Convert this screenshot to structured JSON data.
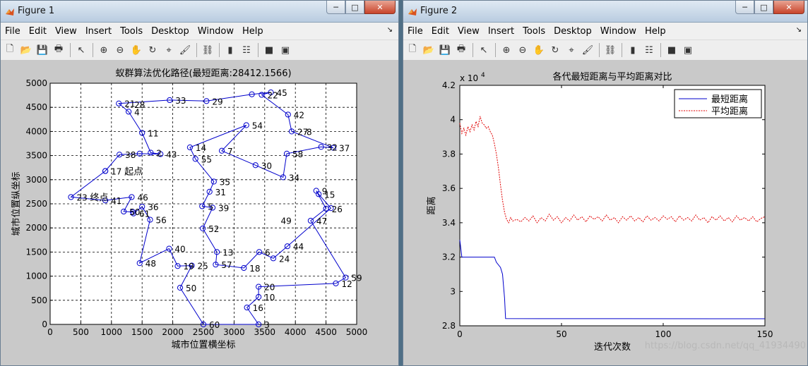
{
  "window1": {
    "title": "Figure 1",
    "menus": [
      "File",
      "Edit",
      "View",
      "Insert",
      "Tools",
      "Desktop",
      "Window",
      "Help"
    ],
    "toolbar_icons": [
      "new-file-icon",
      "open-folder-icon",
      "save-icon",
      "print-icon",
      "|",
      "pointer-icon",
      "|",
      "zoom-in-icon",
      "zoom-out-icon",
      "pan-hand-icon",
      "rotate-icon",
      "data-cursor-icon",
      "brush-icon",
      "|",
      "link-plot-icon",
      "|",
      "colorbar-icon",
      "legend-icon",
      "|",
      "hide-plot-tools-icon",
      "show-plot-tools-icon"
    ]
  },
  "window2": {
    "title": "Figure 2",
    "menus": [
      "File",
      "Edit",
      "View",
      "Insert",
      "Tools",
      "Desktop",
      "Window",
      "Help"
    ],
    "toolbar_icons": [
      "new-file-icon",
      "open-folder-icon",
      "save-icon",
      "print-icon",
      "|",
      "pointer-icon",
      "|",
      "zoom-in-icon",
      "zoom-out-icon",
      "pan-hand-icon",
      "rotate-icon",
      "data-cursor-icon",
      "brush-icon",
      "|",
      "link-plot-icon",
      "|",
      "colorbar-icon",
      "legend-icon",
      "|",
      "hide-plot-tools-icon",
      "show-plot-tools-icon"
    ]
  },
  "chart_data": [
    {
      "type": "line",
      "title": "蚁群算法优化路径(最短距离:28412.1566)",
      "xlabel": "城市位置横坐标",
      "ylabel": "城市位置纵坐标",
      "xlim": [
        0,
        5000
      ],
      "ylim": [
        0,
        5000
      ],
      "xticks": [
        0,
        500,
        1000,
        1500,
        2000,
        2500,
        3000,
        3500,
        4000,
        4500,
        5000
      ],
      "yticks": [
        0,
        500,
        1000,
        1500,
        2000,
        2500,
        3000,
        3500,
        4000,
        4500,
        5000
      ],
      "grid": true,
      "line_color": "#0000cc",
      "marker": "circle",
      "start_label": "起点",
      "end_label": "终点",
      "route": [
        [
          900,
          3180
        ],
        [
          340,
          2640
        ],
        [
          900,
          2570
        ],
        [
          1330,
          2640
        ],
        [
          1200,
          2340
        ],
        [
          1350,
          2330
        ],
        [
          1360,
          2300
        ],
        [
          1500,
          2440
        ],
        [
          1630,
          2170
        ],
        [
          1460,
          1270
        ],
        [
          1940,
          1570
        ],
        [
          2080,
          1210
        ],
        [
          2310,
          1220
        ],
        [
          2120,
          760
        ],
        [
          2500,
          0
        ],
        [
          3400,
          0
        ],
        [
          3210,
          350
        ],
        [
          3400,
          570
        ],
        [
          3400,
          780
        ],
        [
          4660,
          850
        ],
        [
          4820,
          970
        ],
        [
          4250,
          2150
        ],
        [
          4500,
          2400
        ],
        [
          4340,
          2770
        ],
        [
          4380,
          2700
        ],
        [
          4580,
          2410
        ],
        [
          3870,
          1620
        ],
        [
          3640,
          1370
        ],
        [
          3410,
          1500
        ],
        [
          3160,
          1170
        ],
        [
          2700,
          1240
        ],
        [
          2720,
          1500
        ],
        [
          2490,
          1990
        ],
        [
          2650,
          2420
        ],
        [
          2480,
          2450
        ],
        [
          2600,
          2750
        ],
        [
          2670,
          2960
        ],
        [
          2370,
          3430
        ],
        [
          2280,
          3670
        ],
        [
          3200,
          4130
        ],
        [
          2800,
          3600
        ],
        [
          3350,
          3300
        ],
        [
          3800,
          3050
        ],
        [
          3860,
          3540
        ],
        [
          4420,
          3680
        ],
        [
          4620,
          3660
        ],
        [
          3940,
          4000
        ],
        [
          3880,
          4350
        ],
        [
          3450,
          4760
        ],
        [
          3600,
          4810
        ],
        [
          3290,
          4770
        ],
        [
          2550,
          4630
        ],
        [
          1950,
          4650
        ],
        [
          1120,
          4580
        ],
        [
          1280,
          4410
        ],
        [
          1500,
          3970
        ],
        [
          1640,
          3560
        ],
        [
          1800,
          3530
        ],
        [
          1460,
          3540
        ],
        [
          1130,
          3520
        ],
        [
          900,
          3180
        ]
      ],
      "point_labels": [
        {
          "x": 900,
          "y": 3180,
          "text": "17"
        },
        {
          "x": 340,
          "y": 2640,
          "text": "23"
        },
        {
          "x": 900,
          "y": 2570,
          "text": "41"
        },
        {
          "x": 1330,
          "y": 2640,
          "text": "46"
        },
        {
          "x": 1200,
          "y": 2340,
          "text": "50"
        },
        {
          "x": 1360,
          "y": 2300,
          "text": "61"
        },
        {
          "x": 1500,
          "y": 2440,
          "text": "36"
        },
        {
          "x": 1630,
          "y": 2170,
          "text": "56"
        },
        {
          "x": 1460,
          "y": 1270,
          "text": "48"
        },
        {
          "x": 1940,
          "y": 1570,
          "text": "40"
        },
        {
          "x": 2080,
          "y": 1210,
          "text": "19"
        },
        {
          "x": 2310,
          "y": 1220,
          "text": "25"
        },
        {
          "x": 2120,
          "y": 760,
          "text": "50"
        },
        {
          "x": 2500,
          "y": 0,
          "text": "60"
        },
        {
          "x": 3400,
          "y": 0,
          "text": "3"
        },
        {
          "x": 3210,
          "y": 350,
          "text": "16"
        },
        {
          "x": 3400,
          "y": 570,
          "text": "10"
        },
        {
          "x": 3400,
          "y": 780,
          "text": "20"
        },
        {
          "x": 4660,
          "y": 850,
          "text": "12"
        },
        {
          "x": 4820,
          "y": 970,
          "text": "59"
        },
        {
          "x": 4250,
          "y": 2150,
          "text": "47"
        },
        {
          "x": 4500,
          "y": 2400,
          "text": "26"
        },
        {
          "x": 4340,
          "y": 2770,
          "text": "9"
        },
        {
          "x": 4380,
          "y": 2700,
          "text": "15"
        },
        {
          "x": 3870,
          "y": 1620,
          "text": "44"
        },
        {
          "x": 3640,
          "y": 1370,
          "text": "24"
        },
        {
          "x": 3410,
          "y": 1500,
          "text": "6"
        },
        {
          "x": 3160,
          "y": 1170,
          "text": "18"
        },
        {
          "x": 2700,
          "y": 1240,
          "text": "57"
        },
        {
          "x": 2720,
          "y": 1500,
          "text": "13"
        },
        {
          "x": 2490,
          "y": 1990,
          "text": "52"
        },
        {
          "x": 2650,
          "y": 2420,
          "text": "39"
        },
        {
          "x": 2480,
          "y": 2450,
          "text": "5"
        },
        {
          "x": 2600,
          "y": 2750,
          "text": "31"
        },
        {
          "x": 2670,
          "y": 2960,
          "text": "35"
        },
        {
          "x": 2370,
          "y": 3430,
          "text": "55"
        },
        {
          "x": 2280,
          "y": 3670,
          "text": "14"
        },
        {
          "x": 3200,
          "y": 4130,
          "text": "54"
        },
        {
          "x": 2800,
          "y": 3600,
          "text": "7"
        },
        {
          "x": 3350,
          "y": 3300,
          "text": "30"
        },
        {
          "x": 3800,
          "y": 3050,
          "text": "34"
        },
        {
          "x": 3860,
          "y": 3540,
          "text": "58"
        },
        {
          "x": 4420,
          "y": 3680,
          "text": "32"
        },
        {
          "x": 4620,
          "y": 3660,
          "text": "37"
        },
        {
          "x": 3940,
          "y": 4000,
          "text": "27"
        },
        {
          "x": 4090,
          "y": 4000,
          "text": "8"
        },
        {
          "x": 3670,
          "y": 2160,
          "text": "49"
        },
        {
          "x": 3880,
          "y": 4350,
          "text": "42"
        },
        {
          "x": 3450,
          "y": 4760,
          "text": "22"
        },
        {
          "x": 3600,
          "y": 4810,
          "text": "45"
        },
        {
          "x": 2550,
          "y": 4630,
          "text": "29"
        },
        {
          "x": 1950,
          "y": 4650,
          "text": "33"
        },
        {
          "x": 1120,
          "y": 4580,
          "text": "21"
        },
        {
          "x": 1280,
          "y": 4560,
          "text": "28"
        },
        {
          "x": 1280,
          "y": 4410,
          "text": "4"
        },
        {
          "x": 1500,
          "y": 3970,
          "text": "11"
        },
        {
          "x": 1640,
          "y": 3560,
          "text": "2"
        },
        {
          "x": 1800,
          "y": 3530,
          "text": "43"
        },
        {
          "x": 1130,
          "y": 3520,
          "text": "38"
        }
      ]
    },
    {
      "type": "line",
      "title": "各代最短距离与平均距离对比",
      "xlabel": "迭代次数",
      "ylabel": "距离",
      "xlim": [
        0,
        150
      ],
      "ylim": [
        28000,
        42000
      ],
      "xticks": [
        0,
        50,
        100,
        150
      ],
      "yticks": [
        "2.8",
        "3",
        "3.2",
        "3.4",
        "3.6",
        "3.8",
        "4",
        "4.2"
      ],
      "y_exponent_label": "x 10",
      "y_exponent": "4",
      "grid": false,
      "legend_position": "top-right",
      "series": [
        {
          "name": "最短距离",
          "color": "#0000cc",
          "dash": "solid",
          "points": [
            [
              0,
              33000
            ],
            [
              1,
              32000
            ],
            [
              17,
              32000
            ],
            [
              18,
              31700
            ],
            [
              20,
              31400
            ],
            [
              21,
              31000
            ],
            [
              22,
              29600
            ],
            [
              22.5,
              28420
            ],
            [
              150,
              28412
            ]
          ]
        },
        {
          "name": "平均距离",
          "color": "#e00000",
          "dash": "dotted",
          "points": [
            [
              0,
              39800
            ],
            [
              1,
              39200
            ],
            [
              2,
              39500
            ],
            [
              3,
              39100
            ],
            [
              4,
              39600
            ],
            [
              5,
              39300
            ],
            [
              6,
              39700
            ],
            [
              7,
              39400
            ],
            [
              8,
              39900
            ],
            [
              9,
              39600
            ],
            [
              10,
              40200
            ],
            [
              11,
              39800
            ],
            [
              12,
              39700
            ],
            [
              13,
              39500
            ],
            [
              14,
              39600
            ],
            [
              15,
              39300
            ],
            [
              16,
              39100
            ],
            [
              17,
              38600
            ],
            [
              18,
              38000
            ],
            [
              19,
              37200
            ],
            [
              20,
              36200
            ],
            [
              21,
              35300
            ],
            [
              22,
              34600
            ],
            [
              23,
              34200
            ],
            [
              24,
              34000
            ],
            [
              25,
              34300
            ],
            [
              26,
              34100
            ],
            [
              28,
              34200
            ],
            [
              30,
              34050
            ],
            [
              32,
              34300
            ],
            [
              34,
              34100
            ],
            [
              36,
              34400
            ],
            [
              38,
              34000
            ],
            [
              40,
              34300
            ],
            [
              42,
              34100
            ],
            [
              44,
              34500
            ],
            [
              46,
              34150
            ],
            [
              48,
              34350
            ],
            [
              50,
              34000
            ],
            [
              52,
              34300
            ],
            [
              54,
              34100
            ],
            [
              56,
              34450
            ],
            [
              58,
              34150
            ],
            [
              60,
              34350
            ],
            [
              62,
              34050
            ],
            [
              64,
              34400
            ],
            [
              66,
              34200
            ],
            [
              68,
              34350
            ],
            [
              70,
              34100
            ],
            [
              72,
              34450
            ],
            [
              74,
              34150
            ],
            [
              76,
              34300
            ],
            [
              78,
              34000
            ],
            [
              80,
              34350
            ],
            [
              82,
              34150
            ],
            [
              84,
              34400
            ],
            [
              86,
              34100
            ],
            [
              88,
              34300
            ],
            [
              90,
              34050
            ],
            [
              92,
              34400
            ],
            [
              94,
              34150
            ],
            [
              96,
              34300
            ],
            [
              98,
              34100
            ],
            [
              100,
              34400
            ],
            [
              102,
              34200
            ],
            [
              104,
              34350
            ],
            [
              106,
              34050
            ],
            [
              108,
              34400
            ],
            [
              110,
              34150
            ],
            [
              112,
              34300
            ],
            [
              114,
              34100
            ],
            [
              116,
              34450
            ],
            [
              118,
              34150
            ],
            [
              120,
              34300
            ],
            [
              122,
              34000
            ],
            [
              124,
              34350
            ],
            [
              126,
              34150
            ],
            [
              128,
              34400
            ],
            [
              130,
              34100
            ],
            [
              132,
              34300
            ],
            [
              134,
              34050
            ],
            [
              136,
              34400
            ],
            [
              138,
              34150
            ],
            [
              140,
              34300
            ],
            [
              142,
              34100
            ],
            [
              144,
              34350
            ],
            [
              146,
              34050
            ],
            [
              148,
              34250
            ],
            [
              150,
              34350
            ]
          ]
        }
      ]
    }
  ],
  "watermark": "https://blog.csdn.net/qq_41934490"
}
